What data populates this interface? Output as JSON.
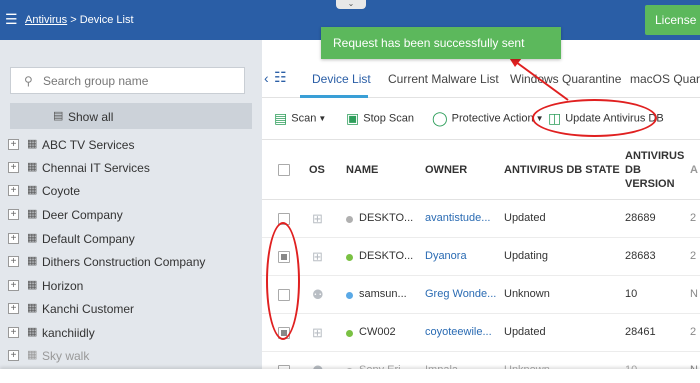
{
  "header": {
    "breadcrumb_link": "Antivirus",
    "breadcrumb_sep": " > ",
    "breadcrumb_current": "Device List",
    "license_label": "License"
  },
  "toast": {
    "message": "Request has been successfully sent"
  },
  "sidebar": {
    "search_placeholder": "Search group name",
    "show_all": "Show all",
    "groups": [
      "ABC TV Services",
      "Chennai IT Services",
      "Coyote",
      "Deer Company",
      "Default Company",
      "Dithers Construction Company",
      "Horizon",
      "Kanchi Customer",
      "kanchiidly",
      "Sky walk"
    ]
  },
  "tabs": [
    {
      "label": "Device List",
      "active": true
    },
    {
      "label": "Current Malware List",
      "active": false
    },
    {
      "label": "Windows Quarantine",
      "active": false
    },
    {
      "label": "macOS Quaran",
      "active": false
    }
  ],
  "toolbar": {
    "scan": "Scan",
    "stop_scan": "Stop Scan",
    "protective_action": "Protective Action",
    "update_db": "Update Antivirus DB"
  },
  "table": {
    "headers": {
      "os": "OS",
      "name": "NAME",
      "owner": "OWNER",
      "state": "ANTIVIRUS DB STATE",
      "version_1": "ANTIVIRUS",
      "version_2": "DB",
      "version_3": "VERSION",
      "extra": "A"
    },
    "rows": [
      {
        "os": "windows",
        "status_color": "#b0b0b0",
        "name": "DESKTO...",
        "owner": "avantistude...",
        "state": "Updated",
        "version": "28689",
        "extra": "2",
        "checked": false
      },
      {
        "os": "windows",
        "status_color": "#7ac143",
        "name": "DESKTO...",
        "owner": "Dyanora",
        "state": "Updating",
        "version": "28683",
        "extra": "2",
        "checked": true
      },
      {
        "os": "android",
        "status_color": "#5aa9e6",
        "name": "samsun...",
        "owner": "Greg Wonde...",
        "state": "Unknown",
        "version": "10",
        "extra": "N",
        "checked": false
      },
      {
        "os": "windows",
        "status_color": "#7ac143",
        "name": "CW002",
        "owner": "coyoteewile...",
        "state": "Updated",
        "version": "28461",
        "extra": "2",
        "checked": true
      },
      {
        "os": "android",
        "status_color": "#c0c0c0",
        "name": "Sony Eri...",
        "owner": "Impala",
        "state": "Unknown",
        "version": "10",
        "extra": "N",
        "checked": false
      }
    ]
  },
  "colors": {
    "header": "#2a5ea6",
    "toast": "#5cb85c",
    "accent": "#3a9fd6",
    "annotation": "#e02020"
  }
}
